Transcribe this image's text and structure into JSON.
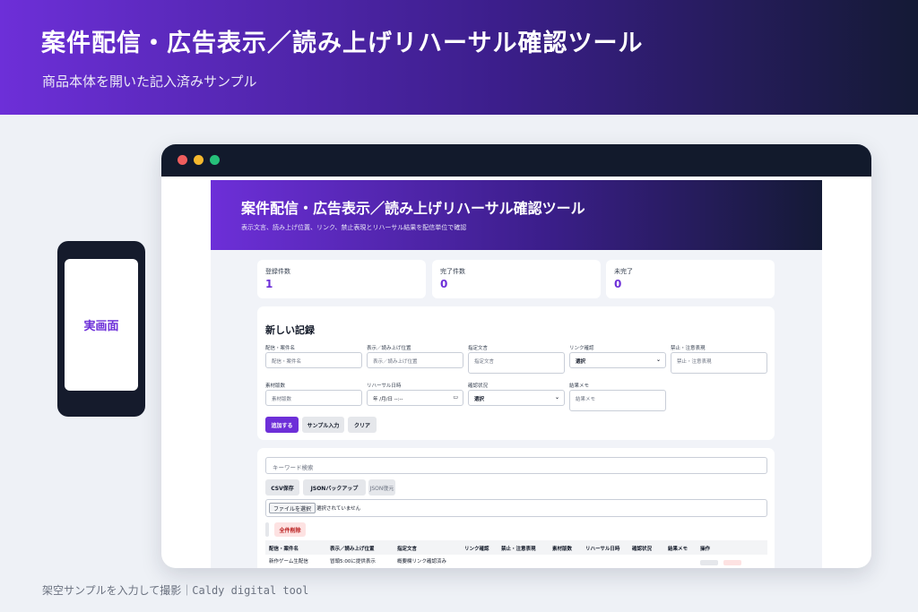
{
  "banner": {
    "title": "案件配信・広告表示／読み上げリハーサル確認ツール",
    "subtitle": "商品本体を開いた記入済みサンプル"
  },
  "phone": {
    "label": "実画面"
  },
  "app": {
    "title": "案件配信・広告表示／読み上げリハーサル確認ツール",
    "subtitle": "表示文言、読み上げ位置、リンク、禁止表現とリハーサル結果を配信単位で確認"
  },
  "stats": [
    {
      "label": "登録件数",
      "value": "1"
    },
    {
      "label": "完了件数",
      "value": "0"
    },
    {
      "label": "未完了",
      "value": "0"
    }
  ],
  "form": {
    "title": "新しい記録",
    "fields": {
      "name": {
        "label": "配信・案件名",
        "placeholder": "配信・案件名"
      },
      "position": {
        "label": "表示／読み上げ位置",
        "placeholder": "表示／読み上げ位置"
      },
      "text": {
        "label": "指定文言",
        "placeholder": "指定文言"
      },
      "link": {
        "label": "リンク確認",
        "value": "選択"
      },
      "banned": {
        "label": "禁止・注意表現",
        "placeholder": "禁止・注意表現"
      },
      "version": {
        "label": "素材版数",
        "placeholder": "素材版数"
      },
      "date": {
        "label": "リハーサル日時",
        "value": "年 /月/日 --:--"
      },
      "status": {
        "label": "確認状況",
        "value": "選択"
      },
      "memo": {
        "label": "結果メモ",
        "placeholder": "結果メモ"
      }
    },
    "buttons": {
      "add": "追加する",
      "sample": "サンプル入力",
      "clear": "クリア"
    }
  },
  "list": {
    "search_placeholder": "キーワード検索",
    "buttons": {
      "csv": "CSV保存",
      "backup": "JSONバックアップ",
      "restore": "JSON復元",
      "delete_all": "全件削除"
    },
    "file": {
      "button": "ファイルを選択",
      "status": "選択されていません"
    },
    "columns": [
      "配信・案件名",
      "表示／読み上げ位置",
      "指定文言",
      "リンク確認",
      "禁止・注意表現",
      "素材版数",
      "リハーサル日時",
      "確認状況",
      "結果メモ",
      "操作"
    ],
    "rows": [
      {
        "name": "新作ゲーム生配信",
        "position": "冒頭5:00に提供表示",
        "text": "概要欄リンク確認済み"
      }
    ]
  },
  "footer": "架空サンプルを入力して撮影｜Caldy digital tool",
  "colors": {
    "accent": "#6d2fd8",
    "dark": "#141a35",
    "danger": "#b91c1c"
  }
}
